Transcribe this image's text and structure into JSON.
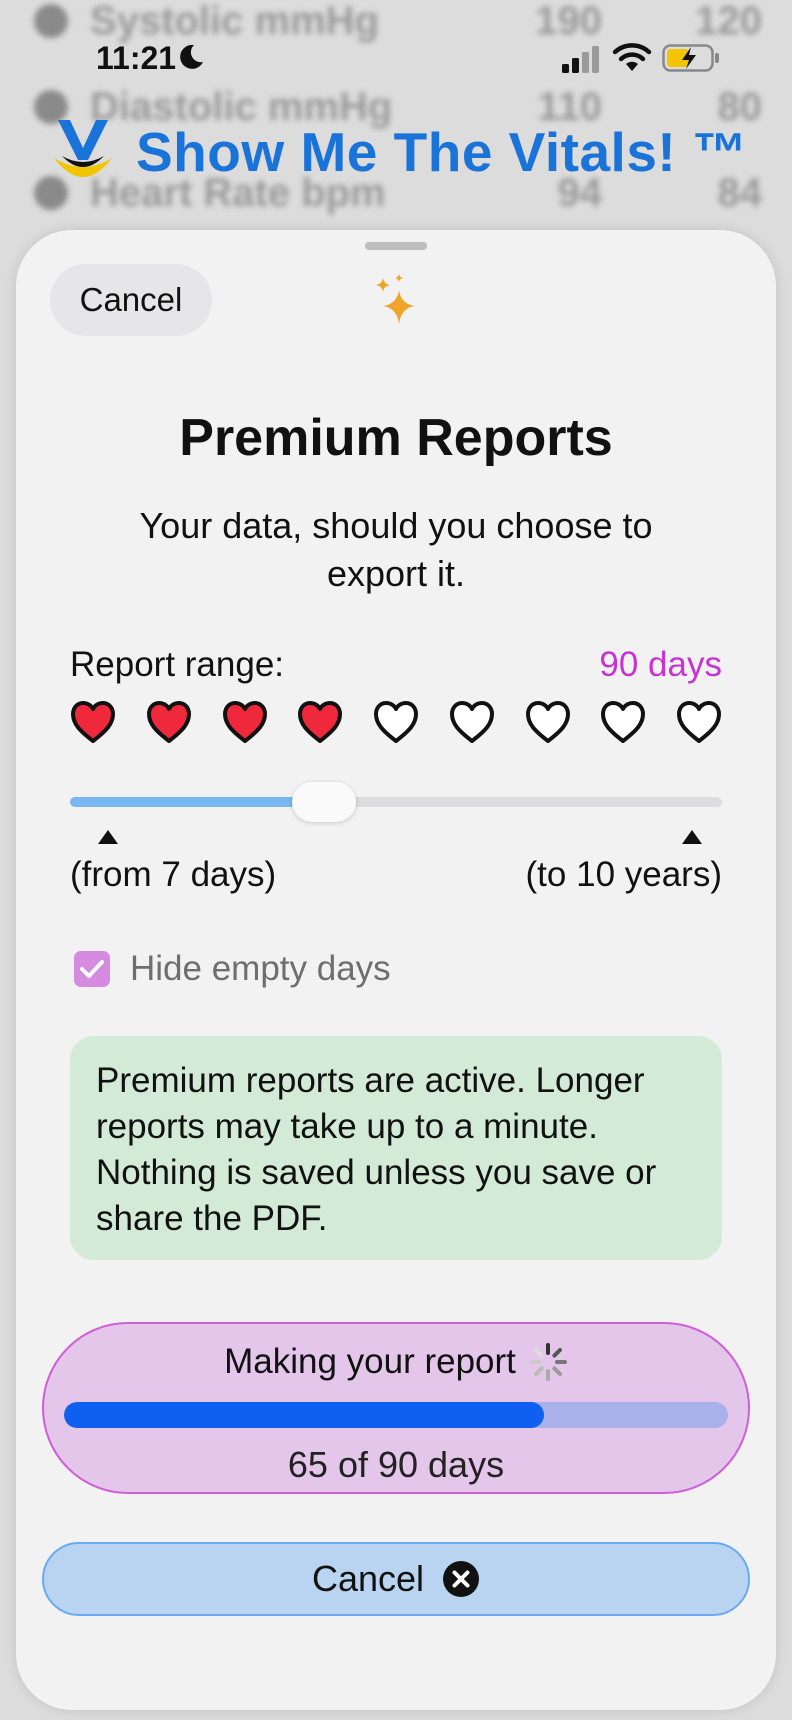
{
  "status_bar": {
    "time": "11:21"
  },
  "app": {
    "title": "Show Me The Vitals! ™",
    "accent": "#1a73d9"
  },
  "background_rows": [
    {
      "label": "Systolic mmHg",
      "v1": "190",
      "v2": "120"
    },
    {
      "label": "Diastolic mmHg",
      "v1": "110",
      "v2": "80"
    },
    {
      "label": "Heart Rate bpm",
      "v1": "94",
      "v2": "84"
    }
  ],
  "sheet": {
    "cancel_label": "Cancel",
    "title": "Premium Reports",
    "subtitle": "Your data, should you choose to export it.",
    "range_label": "Report range:",
    "range_value": "90 days",
    "range_value_color": "#c634d2",
    "hearts": {
      "total": 9,
      "filled": 4
    },
    "slider_fraction": 0.39,
    "from_label": "(from 7 days)",
    "to_label": "(to 10 years)",
    "hide_empty_label": "Hide empty days",
    "hide_empty_checked": true,
    "notice": "Premium reports are active. Longer reports may take up to a minute. Nothing is saved unless you save or share the PDF.",
    "progress": {
      "title": "Making your report",
      "done": "65",
      "of_text": "of 90 days",
      "fraction": 0.7222
    },
    "cancel_bottom_label": "Cancel"
  }
}
